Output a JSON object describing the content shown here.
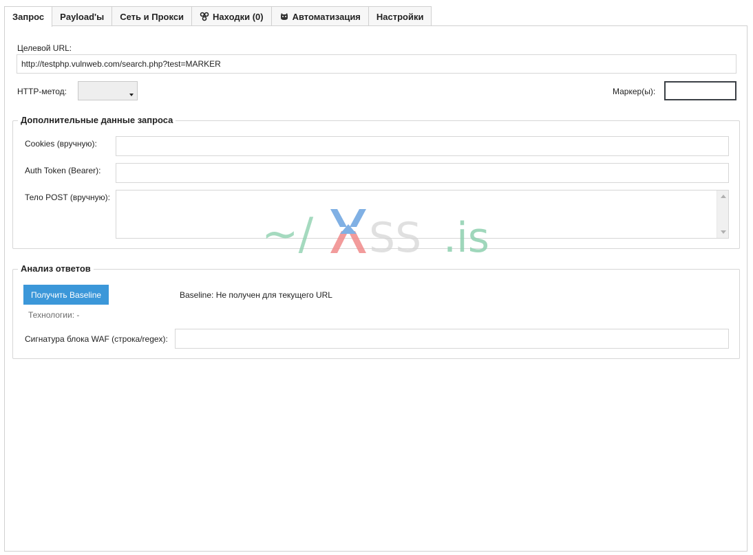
{
  "tabs": [
    {
      "label": "Запрос",
      "icon": null,
      "active": true
    },
    {
      "label": "Payload'ы",
      "icon": null,
      "active": false
    },
    {
      "label": "Сеть и Прокси",
      "icon": null,
      "active": false
    },
    {
      "label": "Находки (0)",
      "icon": "findings-icon",
      "active": false
    },
    {
      "label": "Автоматизация",
      "icon": "automation-icon",
      "active": false
    },
    {
      "label": "Настройки",
      "icon": null,
      "active": false
    }
  ],
  "request": {
    "target_url_label": "Целевой URL:",
    "target_url_value": "http://testphp.vulnweb.com/search.php?test=MARKER",
    "http_method_label": "HTTP-метод:",
    "http_method_value": "",
    "marker_label": "Маркер(ы):",
    "marker_value": ""
  },
  "extra": {
    "legend": "Дополнительные данные запроса",
    "cookies_label": "Cookies (вручную):",
    "cookies_value": "",
    "auth_label": "Auth Token (Bearer):",
    "auth_value": "",
    "post_label": "Тело POST (вручную):",
    "post_value": ""
  },
  "analysis": {
    "legend": "Анализ ответов",
    "baseline_button": "Получить Baseline",
    "baseline_status": "Baseline: Не получен для текущего URL",
    "technologies": "Технологии: -",
    "waf_label": "Сигнатура блока WAF (строка/regex):",
    "waf_value": ""
  },
  "watermark": {
    "text": "XSS.is"
  },
  "colors": {
    "accent_button": "#3b97d9",
    "border": "#d6d6d6",
    "tab_bg": "#f7f7f7",
    "watermark_green": "#8fd1b0",
    "watermark_red": "#f08a8a",
    "watermark_blue": "#6aa3e0"
  }
}
